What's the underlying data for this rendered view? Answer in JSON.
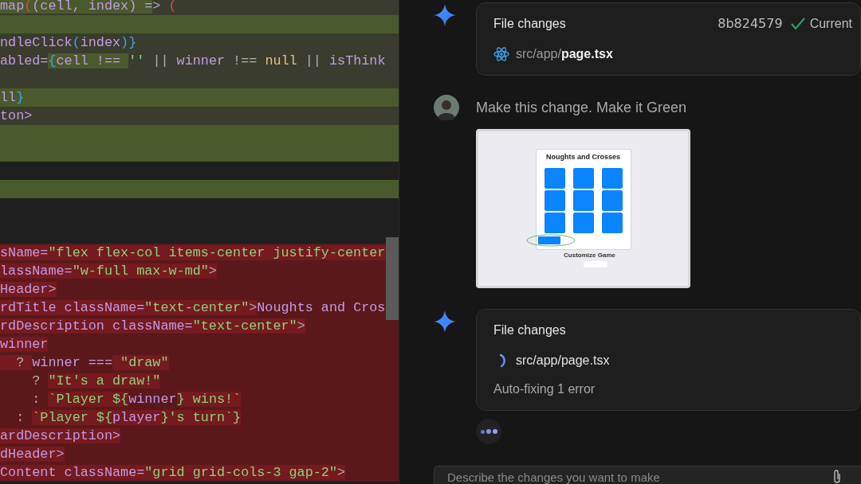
{
  "editor": {
    "lines": [
      {
        "kind": "modified",
        "tokens": [
          {
            "t": "map",
            "kind": "ident",
            "hl": true
          },
          {
            "t": "(",
            "kind": "paren",
            "hl": true
          },
          {
            "t": "(cell, index) =",
            "kind": "ident",
            "hl": true
          },
          {
            "t": "> ",
            "kind": "op",
            "hl": false
          },
          {
            "t": "(",
            "kind": "paren",
            "hl": false
          }
        ]
      },
      {
        "kind": "added"
      },
      {
        "kind": "modified",
        "tokens": [
          {
            "t": "ndleClick",
            "kind": "ident",
            "hl": false
          },
          {
            "t": "(",
            "kind": "brace",
            "hl": false
          },
          {
            "t": "index",
            "kind": "ident",
            "hl": false
          },
          {
            "t": ")}",
            "kind": "brace",
            "hl": false
          }
        ]
      },
      {
        "kind": "modified",
        "tokens": [
          {
            "t": "abled",
            "kind": "ident",
            "hl": false
          },
          {
            "t": "=",
            "kind": "op",
            "hl": false
          },
          {
            "t": "{",
            "kind": "brace",
            "hl": true
          },
          {
            "t": "cell !== ",
            "kind": "ident",
            "hl": true
          },
          {
            "t": "''",
            "kind": "str",
            "hl": false
          },
          {
            "t": " || ",
            "kind": "op",
            "hl": false
          },
          {
            "t": "winner",
            "kind": "ident",
            "hl": false
          },
          {
            "t": " !== ",
            "kind": "op",
            "hl": false
          },
          {
            "t": "null",
            "kind": "kw",
            "hl": false
          },
          {
            "t": " || ",
            "kind": "op",
            "hl": false
          },
          {
            "t": "isThink",
            "kind": "ident",
            "hl": false
          }
        ]
      },
      {
        "kind": "modified"
      },
      {
        "kind": "added",
        "tokens": [
          {
            "t": "ll",
            "kind": "ident",
            "hl": false
          },
          {
            "t": "}",
            "kind": "brace",
            "hl": false
          }
        ]
      },
      {
        "kind": "modified",
        "tokens": [
          {
            "t": "ton>",
            "kind": "ident",
            "hl": false
          }
        ]
      },
      {
        "kind": "added"
      },
      {
        "kind": "added"
      },
      {
        "kind": "blank"
      },
      {
        "kind": "added"
      }
    ],
    "removed_lines": [
      {
        "kind": "removed",
        "tokens": [
          {
            "t": "sName=",
            "kind": "ident",
            "hl": true
          },
          {
            "t": "\"flex flex-col items-center justify-center",
            "kind": "str",
            "hl": true
          }
        ]
      },
      {
        "kind": "removed",
        "tokens": [
          {
            "t": "lassName=",
            "kind": "ident",
            "hl": true
          },
          {
            "t": "\"w-full max-w-md\"",
            "kind": "str",
            "hl": true
          },
          {
            "t": ">",
            "kind": "op",
            "hl": true
          }
        ]
      },
      {
        "kind": "removed",
        "tokens": [
          {
            "t": "Header>",
            "kind": "ident",
            "hl": true
          }
        ]
      },
      {
        "kind": "removed",
        "tokens": [
          {
            "t": "rdTitle className=",
            "kind": "ident",
            "hl": true
          },
          {
            "t": "\"text-center\"",
            "kind": "str",
            "hl": true
          },
          {
            "t": ">",
            "kind": "op",
            "hl": true
          },
          {
            "t": "Noughts and Cros",
            "kind": "ident",
            "hl": false
          }
        ]
      },
      {
        "kind": "removed",
        "tokens": [
          {
            "t": "rdDescription className=",
            "kind": "ident",
            "hl": true
          },
          {
            "t": "\"text-center\"",
            "kind": "str",
            "hl": true
          },
          {
            "t": ">",
            "kind": "op",
            "hl": true
          }
        ]
      },
      {
        "kind": "removed",
        "tokens": [
          {
            "t": "winner",
            "kind": "ident",
            "hl": true
          }
        ]
      },
      {
        "kind": "removed",
        "tokens": [
          {
            "t": "  ? ",
            "kind": "op",
            "hl": true
          },
          {
            "t": "winner ===",
            "kind": "ident",
            "hl": false
          },
          {
            "t": " \"draw\"",
            "kind": "str",
            "hl": true
          }
        ]
      },
      {
        "kind": "removed",
        "tokens": [
          {
            "t": "    ? ",
            "kind": "op",
            "hl": false
          },
          {
            "t": "\"It's a draw!\"",
            "kind": "str",
            "hl": true
          }
        ]
      },
      {
        "kind": "removed",
        "tokens": [
          {
            "t": "    : ",
            "kind": "op",
            "hl": false
          },
          {
            "t": "`Player ${",
            "kind": "str",
            "hl": true
          },
          {
            "t": "winner",
            "kind": "ident",
            "hl": false
          },
          {
            "t": "} wins!`",
            "kind": "str",
            "hl": true
          }
        ]
      },
      {
        "kind": "removed",
        "tokens": [
          {
            "t": "  : ",
            "kind": "op",
            "hl": false
          },
          {
            "t": "`Player ${",
            "kind": "str",
            "hl": true
          },
          {
            "t": "player",
            "kind": "ident",
            "hl": true
          },
          {
            "t": "}'s turn`}",
            "kind": "str",
            "hl": true
          }
        ]
      },
      {
        "kind": "removed",
        "tokens": [
          {
            "t": "ardDescription>",
            "kind": "ident",
            "hl": true
          }
        ]
      },
      {
        "kind": "removed",
        "tokens": [
          {
            "t": "dHeader>",
            "kind": "ident",
            "hl": true
          }
        ]
      },
      {
        "kind": "removed",
        "tokens": [
          {
            "t": "Content className=",
            "kind": "ident",
            "hl": true
          },
          {
            "t": "\"grid grid-cols-3 gap-2\"",
            "kind": "str",
            "hl": true
          },
          {
            "t": ">",
            "kind": "op",
            "hl": true
          }
        ]
      }
    ]
  },
  "chat": {
    "messages": [
      {
        "kind": "file_changes",
        "title": "File changes",
        "commit": "8b824579",
        "status": "Current",
        "file": "src/app/**page.tsx**",
        "loading": false
      },
      {
        "kind": "user",
        "text": "Make this change. Make it Green",
        "attachment": {
          "title": "Noughts and Crosses",
          "button_circled": true,
          "section": "Customize Game"
        }
      },
      {
        "kind": "file_changes",
        "title": "File changes",
        "file": "src/app/page.tsx",
        "loading": true,
        "note": "Auto-fixing 1 error"
      },
      {
        "kind": "typing"
      }
    ]
  },
  "input": {
    "placeholder": "Describe the changes you want to make"
  }
}
